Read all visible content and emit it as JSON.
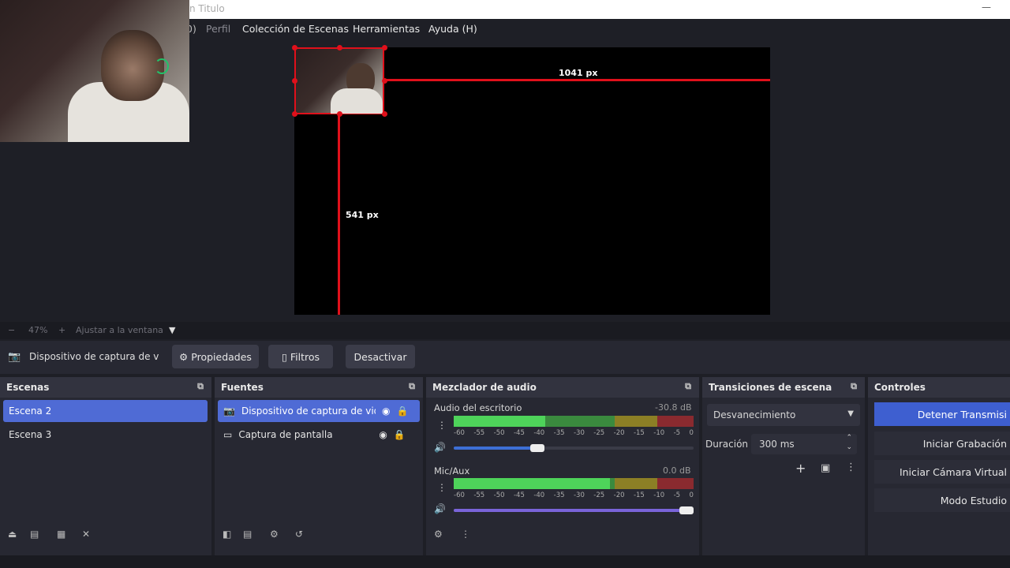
{
  "window": {
    "title": "n Titulo"
  },
  "menu": {
    "items": [
      "Perfil",
      "Colección de Escenas",
      "Herramientas",
      "Ayuda (H)"
    ],
    "partial": "0)"
  },
  "preview": {
    "guide_horizontal": "1041 px",
    "guide_vertical": "541 px",
    "zoom_minus": "−",
    "zoom_percent": "47%",
    "zoom_plus": "+",
    "zoom_mode": "Ajustar a la ventana"
  },
  "source_toolbar": {
    "source_name": "Dispositivo de captura de v",
    "properties": "Propiedades",
    "filters": "Filtros",
    "deactivate": "Desactivar"
  },
  "scenes": {
    "title": "Escenas",
    "items": [
      "Escena 2",
      "Escena 3"
    ],
    "selected": "Escena 2"
  },
  "sources": {
    "title": "Fuentes",
    "items": [
      {
        "label": "Dispositivo de captura de vid",
        "icon": "camera-icon"
      },
      {
        "label": "Captura de pantalla",
        "icon": "monitor-icon"
      }
    ]
  },
  "mixer": {
    "title": "Mezclador de audio",
    "tick_labels": [
      "-60",
      "-55",
      "-50",
      "-45",
      "-40",
      "-35",
      "-30",
      "-25",
      "-20",
      "-15",
      "-10",
      "-5",
      "0"
    ],
    "channels": [
      {
        "name": "Audio del escritorio",
        "db": "-30.8 dB",
        "level": 0.38,
        "volume": 0.35,
        "track_color": "#3d6fd6"
      },
      {
        "name": "Mic/Aux",
        "db": "0.0 dB",
        "level": 0.65,
        "volume": 1.0,
        "track_color": "#7a64d9"
      }
    ]
  },
  "transitions": {
    "title": "Transiciones de escena",
    "selected": "Desvanecimiento",
    "duration_label": "Duración",
    "duration_value": "300 ms"
  },
  "controls": {
    "title": "Controles",
    "buttons": [
      "Detener Transmisi",
      "Iniciar Grabación",
      "Iniciar Cámara Virtual",
      "Modo Estudio"
    ]
  },
  "colors": {
    "accent": "#4f6bd5",
    "guide": "#e0101b",
    "background": "#1e1f26",
    "panel": "#272832"
  }
}
